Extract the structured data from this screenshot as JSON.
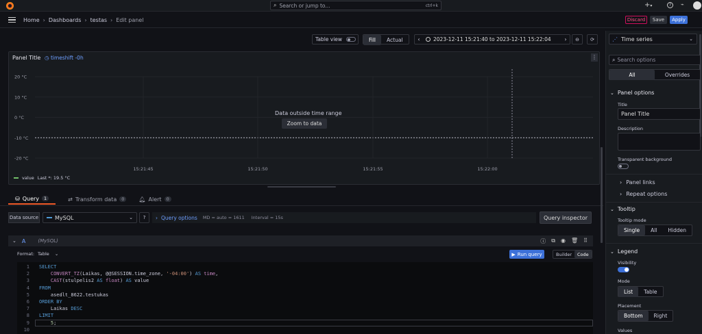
{
  "topbar": {
    "search_placeholder": "Search or jump to...",
    "shortcut": "ctrl+k",
    "plus": "+"
  },
  "navbar": {
    "breadcrumb": [
      "Home",
      "Dashboards",
      "testas",
      "Edit panel"
    ],
    "discard": "Discard",
    "save": "Save",
    "apply": "Apply"
  },
  "toolbar": {
    "table_view": "Table view",
    "fill": "Fill",
    "actual": "Actual",
    "time_range": "2023-12-11 15:21:40 to 2023-12-11 15:22:04"
  },
  "visualization": {
    "type": "Time series"
  },
  "panel": {
    "title": "Panel Title",
    "timeshift": "timeshift -0h",
    "no_data_msg": "Data outside time range",
    "zoom_button": "Zoom to data",
    "legend": "value",
    "legend_last": "Last *: 19.5 °C"
  },
  "chart_data": {
    "type": "line",
    "yticks": [
      "20 °C",
      "10 °C",
      "0 °C",
      "-10 °C",
      "-20 °C"
    ],
    "xticks": [
      "15:21:45",
      "15:21:50",
      "15:21:55",
      "15:22:00"
    ],
    "series": [
      {
        "name": "value",
        "values": []
      }
    ],
    "threshold": -10
  },
  "query_tabs": [
    {
      "label": "Query",
      "count": "1"
    },
    {
      "label": "Transform data",
      "count": "0"
    },
    {
      "label": "Alert",
      "count": "0"
    }
  ],
  "query": {
    "datasource_label": "Data source",
    "datasource": "MySQL",
    "options_label": "Query options",
    "options_info": "MD = auto = 1611",
    "interval": "Interval = 15s",
    "inspector": "Query inspector",
    "ref": "A",
    "ref_ds": "(MySQL)",
    "format_label": "Format:",
    "format": "Table",
    "run": "Run query",
    "builder": "Builder",
    "code": "Code"
  },
  "code_lines": [
    {
      "n": "1",
      "parts": [
        [
          "kw",
          "SELECT"
        ]
      ]
    },
    {
      "n": "2",
      "parts": [
        [
          "",
          "    "
        ],
        [
          "fn",
          "CONVERT_TZ"
        ],
        [
          "",
          "(Laikas, @@SESSION.time_zone, "
        ],
        [
          "str",
          "'-04:00'"
        ],
        [
          "",
          ") "
        ],
        [
          "kw",
          "AS"
        ],
        [
          "fn",
          " time"
        ],
        [
          "",
          ","
        ]
      ]
    },
    {
      "n": "3",
      "parts": [
        [
          "",
          "    "
        ],
        [
          "fn",
          "CAST"
        ],
        [
          "",
          "(stulpelis2 "
        ],
        [
          "kw",
          "AS"
        ],
        [
          "fn",
          " float"
        ],
        [
          "",
          ") "
        ],
        [
          "kw",
          "AS"
        ],
        [
          "",
          " value"
        ]
      ]
    },
    {
      "n": "4",
      "parts": [
        [
          "kw",
          "FROM"
        ]
      ]
    },
    {
      "n": "5",
      "parts": [
        [
          "",
          "    asedlt_8622.testukas"
        ]
      ]
    },
    {
      "n": "6",
      "parts": [
        [
          "kw",
          "ORDER BY"
        ]
      ]
    },
    {
      "n": "7",
      "parts": [
        [
          "",
          "    Laikas "
        ],
        [
          "kw",
          "DESC"
        ]
      ]
    },
    {
      "n": "8",
      "parts": [
        [
          "kw",
          "LIMIT"
        ]
      ]
    },
    {
      "n": "9",
      "parts": [
        [
          "num",
          "    5"
        ],
        [
          "",
          ";"
        ]
      ]
    },
    {
      "n": "10",
      "parts": []
    }
  ],
  "sidebar": {
    "search_placeholder": "Search options",
    "all": "All",
    "overrides": "Overrides",
    "panel_options": "Panel options",
    "title_label": "Title",
    "title_value": "Panel Title",
    "description_label": "Description",
    "transparent_label": "Transparent background",
    "panel_links": "Panel links",
    "repeat_options": "Repeat options",
    "tooltip": "Tooltip",
    "tooltip_mode": "Tooltip mode",
    "tooltip_opts": [
      "Single",
      "All",
      "Hidden"
    ],
    "legend": "Legend",
    "visibility": "Visibility",
    "mode": "Mode",
    "mode_opts": [
      "List",
      "Table"
    ],
    "placement": "Placement",
    "placement_opts": [
      "Bottom",
      "Right"
    ],
    "values": "Values"
  },
  "colors": {
    "accent": "#3d71d9",
    "discard": "#d10e5c",
    "series": "#73bf69"
  }
}
